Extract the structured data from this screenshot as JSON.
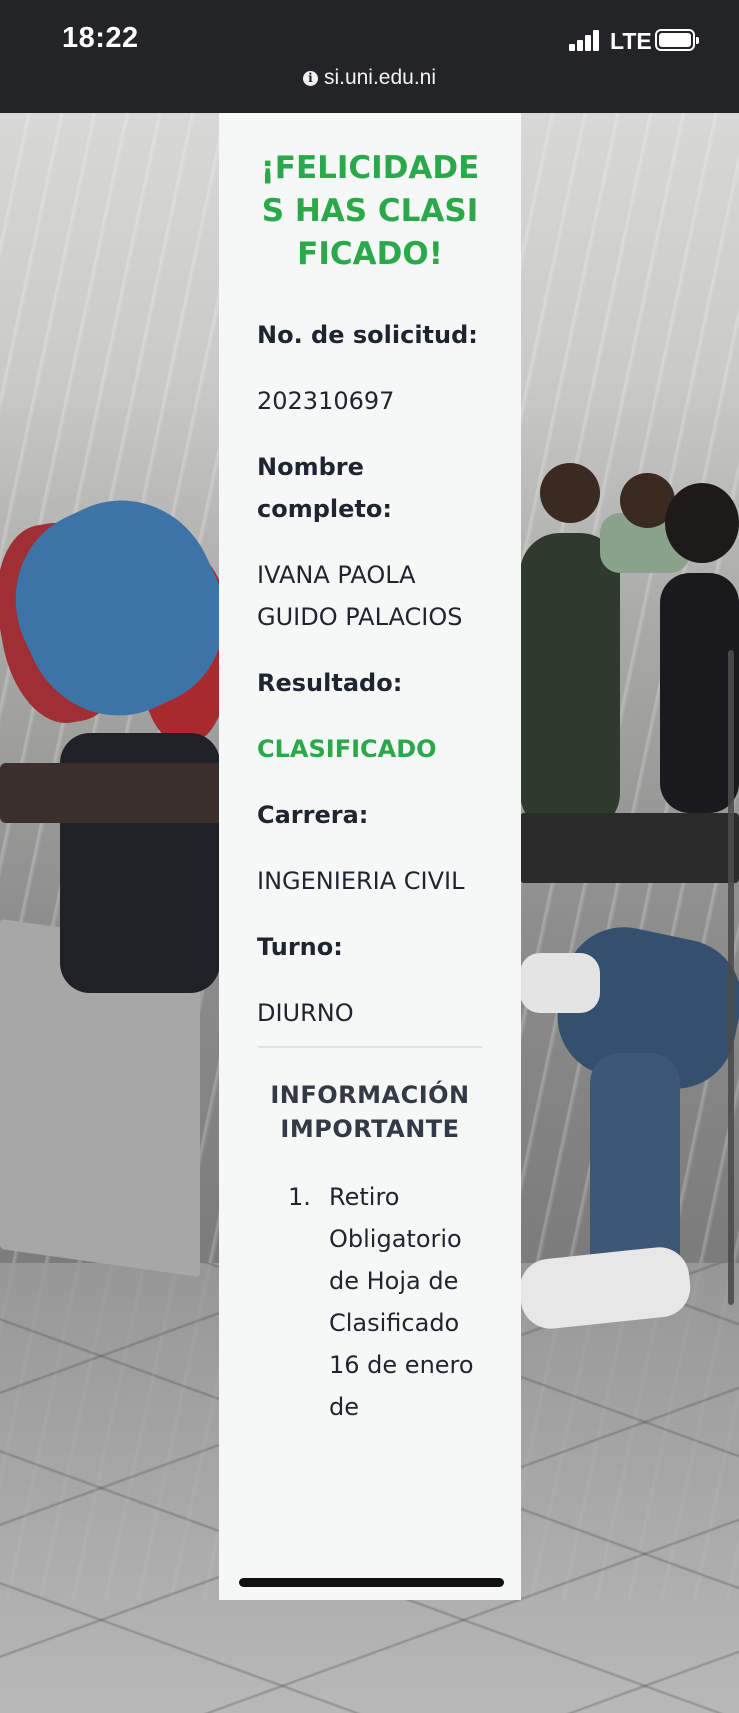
{
  "status_bar": {
    "time": "18:22",
    "network": "LTE"
  },
  "browser": {
    "url": "si.uni.edu.ni",
    "info_icon": "info-icon"
  },
  "result_card": {
    "heading": "¡FELICIDADES HAS CLASIFICADO!",
    "fields": {
      "request_number": {
        "label": "No. de solicitud:",
        "value": "202310697"
      },
      "full_name": {
        "label": "Nombre completo:",
        "value": "IVANA PAOLA GUIDO PALACIOS"
      },
      "result": {
        "label": "Resultado:",
        "value": "CLASIFICADO"
      },
      "career": {
        "label": "Carrera:",
        "value": "INGENIERIA CIVIL"
      },
      "shift": {
        "label": "Turno:",
        "value": "DIURNO"
      }
    },
    "important_info": {
      "title": "INFORMACIÓN IMPORTANTE",
      "items": [
        {
          "number": "1.",
          "text": "Retiro Obligatorio de Hoja de Clasificado 16 de enero de"
        }
      ]
    }
  },
  "colors": {
    "success_green": "#2aa84a",
    "text_dark": "#1f2530",
    "card_bg": "#f6f8f8",
    "topbar_bg": "#232427"
  }
}
